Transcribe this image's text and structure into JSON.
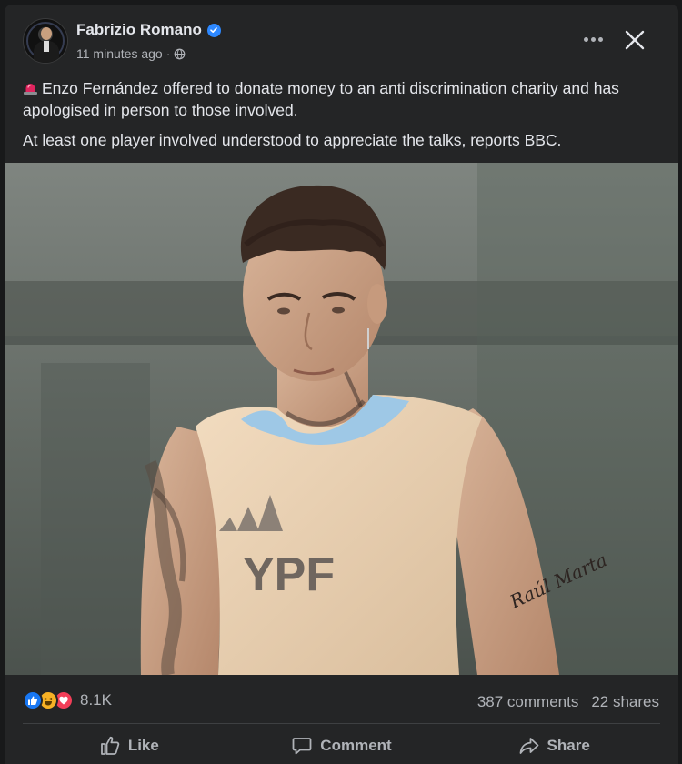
{
  "post": {
    "author": "Fabrizio Romano",
    "timestamp": "11 minutes ago",
    "separator": "·",
    "verified": true,
    "audience_icon": "globe-icon",
    "paragraphs": [
      "Enzo Fernández offered to donate money to an anti discrimination charity and has apologised in person to those involved.",
      "At least one player involved understood to appreciate the talks, reports BBC."
    ],
    "lead_emoji": "siren-emoji",
    "photo": {
      "shirt_text": "YPF",
      "tattoo_text": "Raúl Marta"
    }
  },
  "stats": {
    "reactions": [
      "like",
      "haha",
      "love"
    ],
    "reaction_count": "8.1K",
    "comments": "387 comments",
    "shares": "22 shares"
  },
  "actions": {
    "like": "Like",
    "comment": "Comment",
    "share": "Share"
  },
  "colors": {
    "background": "#242526",
    "text": "#e4e6eb",
    "muted": "#b0b3b8",
    "verified": "#2d88ff",
    "like": "#1877f2",
    "haha": "#f7b125",
    "love": "#f33e58"
  }
}
